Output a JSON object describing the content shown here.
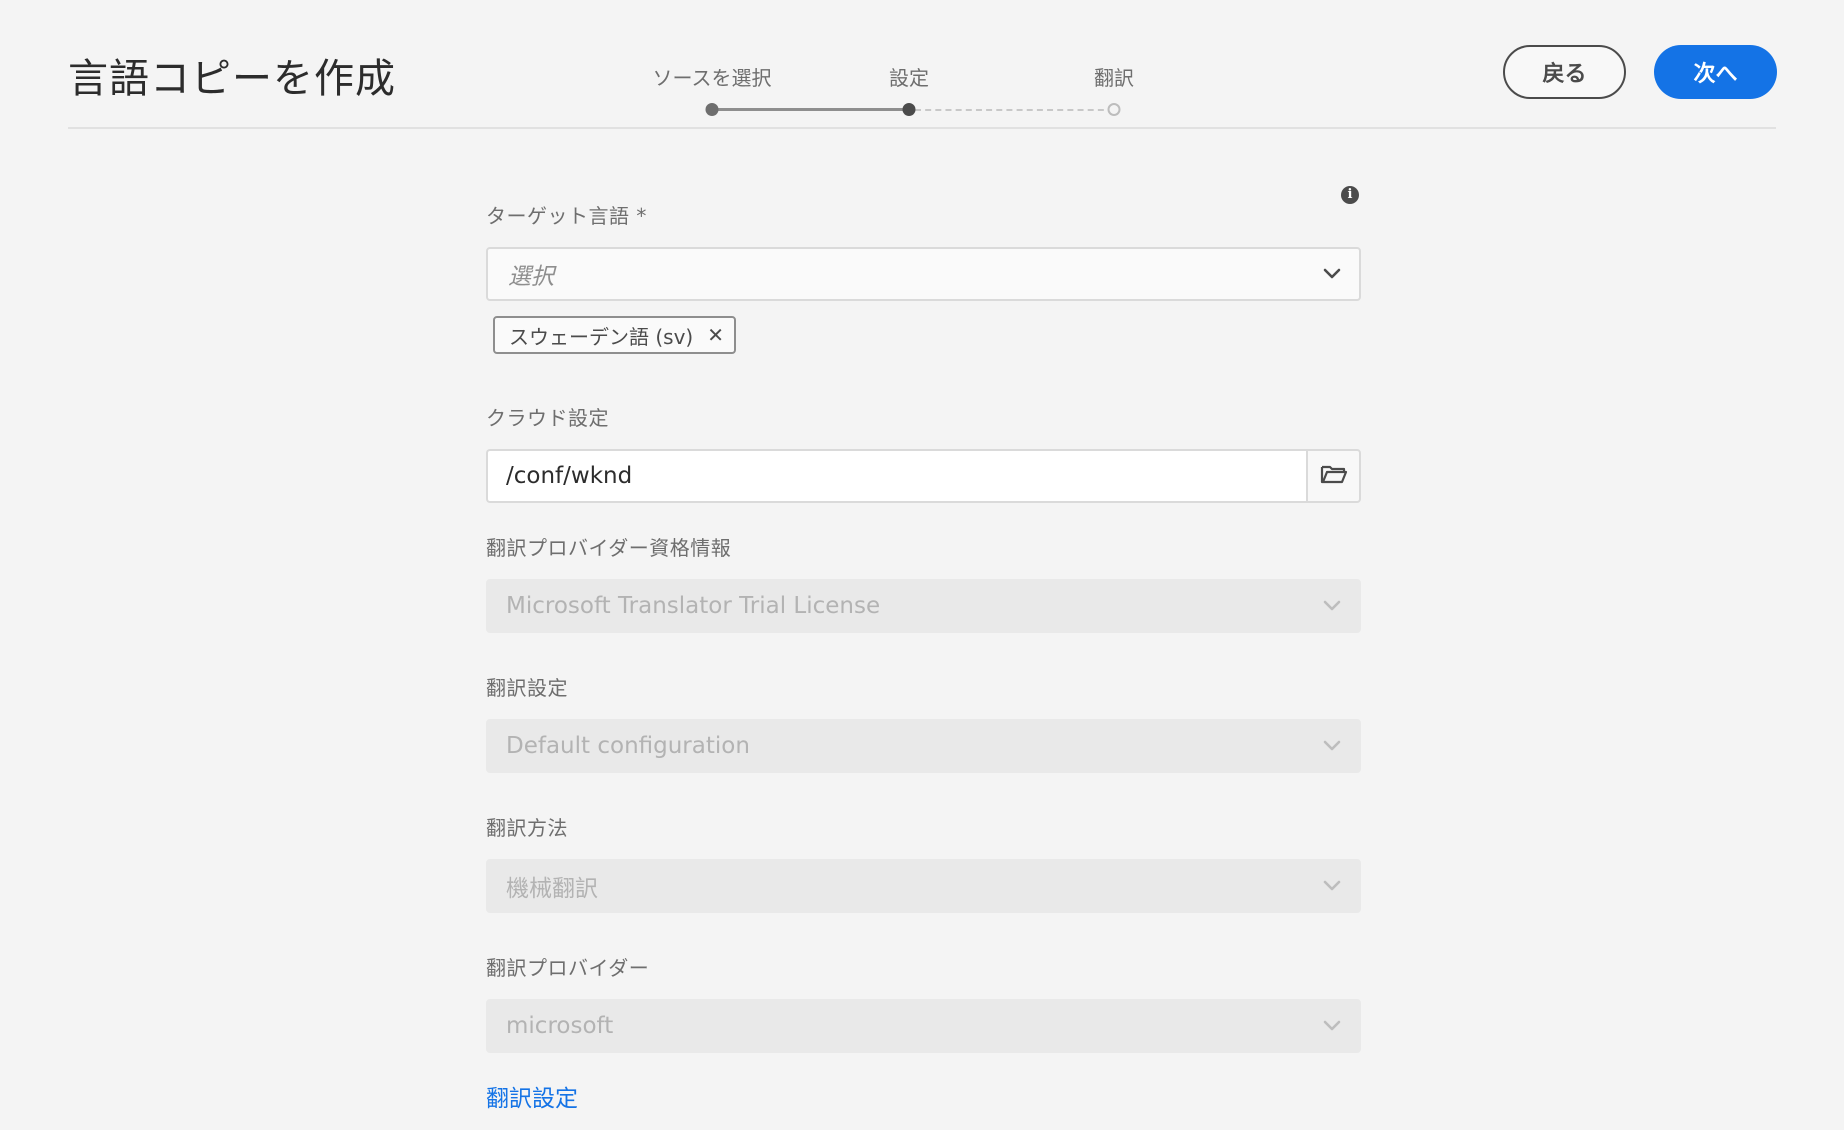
{
  "header": {
    "title": "言語コピーを作成",
    "back_label": "戻る",
    "next_label": "次へ"
  },
  "stepper": {
    "steps": [
      {
        "label": "ソースを選択",
        "state": "done"
      },
      {
        "label": "設定",
        "state": "current"
      },
      {
        "label": "翻訳",
        "state": "todo"
      }
    ]
  },
  "form": {
    "target_language": {
      "label": "ターゲット言語 *",
      "placeholder": "選択",
      "selected_tags": [
        "スウェーデン語 (sv)"
      ]
    },
    "cloud_config": {
      "label": "クラウド設定",
      "value": "/conf/wknd"
    },
    "provider_credentials": {
      "label": "翻訳プロバイダー資格情報",
      "value": "Microsoft Translator Trial License"
    },
    "translation_config": {
      "label": "翻訳設定",
      "value": "Default configuration"
    },
    "translation_method": {
      "label": "翻訳方法",
      "value": "機械翻訳"
    },
    "translation_provider": {
      "label": "翻訳プロバイダー",
      "value": "microsoft"
    },
    "translation_settings_link": "翻訳設定"
  },
  "colors": {
    "accent": "#1473e6",
    "background": "#f4f4f4",
    "disabled_field": "#e9e9e9"
  },
  "icons": {
    "info": "info-icon",
    "chevron": "chevron-down-icon",
    "browse": "folder-icon",
    "remove": "close-icon"
  }
}
